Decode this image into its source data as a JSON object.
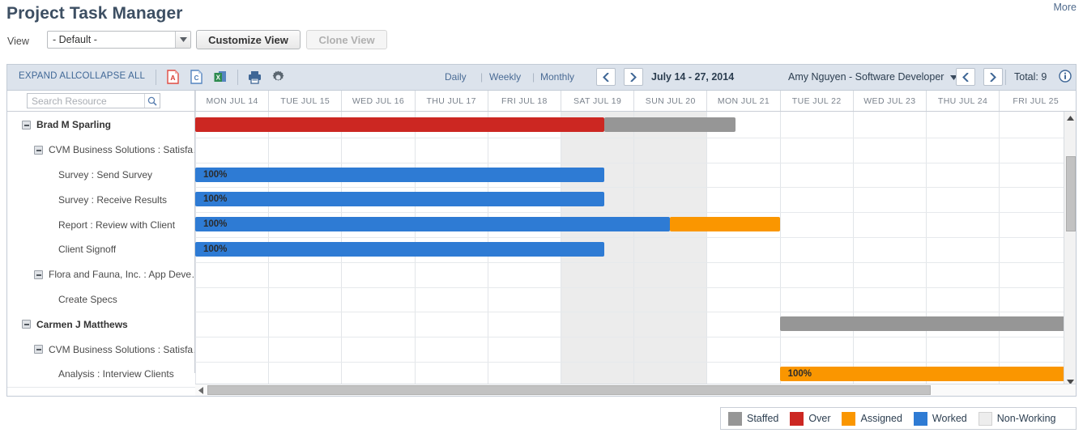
{
  "header": {
    "title": "Project Task Manager",
    "more_label": "More"
  },
  "view_bar": {
    "view_label": "View",
    "view_value": "- Default -",
    "customize_label": "Customize View",
    "clone_label": "Clone View"
  },
  "toolbar": {
    "expand_all": "EXPAND ALL",
    "collapse_all": "COLLAPSE ALL",
    "icons": [
      "pdf-export-icon",
      "csv-export-icon",
      "excel-export-icon",
      "print-icon",
      "settings-gear-icon"
    ],
    "periods": [
      "Daily",
      "Weekly",
      "Monthly"
    ],
    "prev_label": "‹",
    "next_label": "›",
    "date_range": "July 14 - 27, 2014",
    "resource_selector": "Amy  Nguyen - Software Developer",
    "total_label": "Total: 9",
    "info_icon": "info-icon"
  },
  "grid": {
    "search_placeholder": "Search Resource",
    "days": [
      {
        "label": "MON JUL 14",
        "weekend": false
      },
      {
        "label": "TUE JUL 15",
        "weekend": false
      },
      {
        "label": "WED JUL 16",
        "weekend": false
      },
      {
        "label": "THU JUL 17",
        "weekend": false
      },
      {
        "label": "FRI JUL 18",
        "weekend": false
      },
      {
        "label": "SAT JUL 19",
        "weekend": true
      },
      {
        "label": "SUN JUL 20",
        "weekend": true
      },
      {
        "label": "MON JUL 21",
        "weekend": false
      },
      {
        "label": "TUE JUL 22",
        "weekend": false
      },
      {
        "label": "WED JUL 23",
        "weekend": false
      },
      {
        "label": "THU JUL 24",
        "weekend": false
      },
      {
        "label": "FRI JUL 25",
        "weekend": false
      }
    ],
    "rows": [
      {
        "label": "Brad M Sparling",
        "level": 0,
        "expandable": true,
        "bars": [
          {
            "type": "over",
            "start_day": 0,
            "end_day": 5.6,
            "pct": ""
          },
          {
            "type": "staffed",
            "start_day": 5.6,
            "end_day": 7.4,
            "pct": ""
          }
        ]
      },
      {
        "label": "CVM Business Solutions : Satisfa…",
        "level": 1,
        "expandable": true,
        "bars": []
      },
      {
        "label": "Survey : Send Survey",
        "level": 2,
        "expandable": false,
        "bars": [
          {
            "type": "worked",
            "start_day": 0,
            "end_day": 5.6,
            "pct": "100%"
          }
        ]
      },
      {
        "label": "Survey : Receive Results",
        "level": 2,
        "expandable": false,
        "bars": [
          {
            "type": "worked",
            "start_day": 0,
            "end_day": 5.6,
            "pct": "100%"
          }
        ]
      },
      {
        "label": "Report : Review with Client",
        "level": 2,
        "expandable": false,
        "bars": [
          {
            "type": "worked",
            "start_day": 0,
            "end_day": 6.5,
            "pct": "100%"
          },
          {
            "type": "assigned",
            "start_day": 6.5,
            "end_day": 8.0,
            "pct": ""
          }
        ]
      },
      {
        "label": "Client Signoff",
        "level": 2,
        "expandable": false,
        "bars": [
          {
            "type": "worked",
            "start_day": 0,
            "end_day": 5.6,
            "pct": "100%"
          }
        ]
      },
      {
        "label": "Flora and Fauna, Inc. : App Deve…",
        "level": 1,
        "expandable": true,
        "bars": []
      },
      {
        "label": "Create Specs",
        "level": 2,
        "expandable": false,
        "bars": []
      },
      {
        "label": "Carmen J Matthews",
        "level": 0,
        "expandable": true,
        "bars": [
          {
            "type": "staffed",
            "start_day": 8.0,
            "end_day": 12.0,
            "pct": ""
          }
        ]
      },
      {
        "label": "CVM Business Solutions : Satisfa…",
        "level": 1,
        "expandable": true,
        "bars": []
      },
      {
        "label": "Analysis : Interview Clients",
        "level": 2,
        "expandable": false,
        "bars": [
          {
            "type": "assigned",
            "start_day": 8.0,
            "end_day": 12.0,
            "pct": "100%"
          }
        ]
      }
    ]
  },
  "legend": {
    "items": [
      {
        "label": "Staffed",
        "color": "#969696"
      },
      {
        "label": "Over",
        "color": "#cc2722"
      },
      {
        "label": "Assigned",
        "color": "#fa9600"
      },
      {
        "label": "Worked",
        "color": "#2e7bd4"
      },
      {
        "label": "Non-Working",
        "color": "#ededed"
      }
    ]
  },
  "colors": {
    "staffed": "#969696",
    "over": "#cc2722",
    "assigned": "#fa9600",
    "worked": "#2e7bd4",
    "non_working": "#ededed",
    "toolbar_bg": "#dce3ec",
    "title": "#3d4f63"
  }
}
